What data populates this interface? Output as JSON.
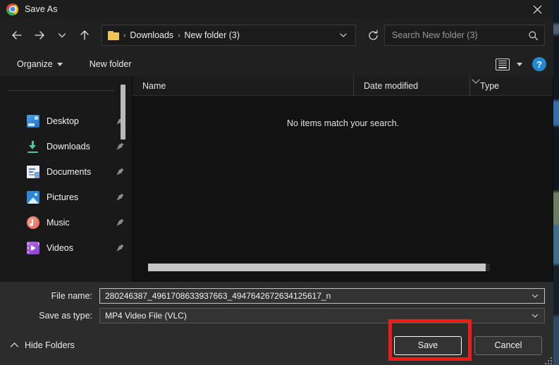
{
  "window": {
    "title": "Save As",
    "app_icon": "chrome-logo-icon",
    "close_label": "×"
  },
  "navbar": {
    "back_icon": "arrow-left-icon",
    "forward_icon": "arrow-right-icon",
    "recent_icon": "chevron-down-icon",
    "up_icon": "arrow-up-icon",
    "refresh_icon": "refresh-icon",
    "address": {
      "folder_icon": "folder-icon",
      "crumbs": [
        "Downloads",
        "New folder (3)"
      ],
      "separator": "›",
      "dropdown_icon": "chevron-down-icon"
    },
    "search": {
      "placeholder": "Search New folder (3)",
      "value": "",
      "icon": "search-icon"
    }
  },
  "toolbar": {
    "organize_label": "Organize",
    "organize_caret": "caret-down-icon",
    "new_folder_label": "New folder",
    "view_icon": "list-view-icon",
    "view_caret": "caret-down-icon",
    "help_label": "?",
    "help_icon": "help-icon"
  },
  "sidebar": {
    "items": [
      {
        "label": "Desktop",
        "icon": "desktop-icon",
        "pin": "pin-icon"
      },
      {
        "label": "Downloads",
        "icon": "downloads-icon",
        "pin": "pin-icon"
      },
      {
        "label": "Documents",
        "icon": "documents-icon",
        "pin": "pin-icon"
      },
      {
        "label": "Pictures",
        "icon": "pictures-icon",
        "pin": "pin-icon"
      },
      {
        "label": "Music",
        "icon": "music-icon",
        "pin": "pin-icon"
      },
      {
        "label": "Videos",
        "icon": "videos-icon",
        "pin": "pin-icon"
      }
    ]
  },
  "filelist": {
    "columns": [
      "Name",
      "Date modified",
      "Type"
    ],
    "sort_indicator": "chevron-up-sort-icon",
    "empty_message": "No items match your search.",
    "rows": []
  },
  "form": {
    "file_name_label": "File name:",
    "file_name_value": "280246387_4961708633937663_4947642672634125617_n",
    "save_as_type_label": "Save as type:",
    "save_as_type_value": "MP4 Video File (VLC)",
    "dropdown_icon": "chevron-down-icon"
  },
  "footer": {
    "hide_folders_label": "Hide Folders",
    "hide_folders_icon": "chevron-up-icon",
    "save_label": "Save",
    "cancel_label": "Cancel",
    "resize_grip_icon": "resize-grip-icon"
  },
  "annotation": {
    "color": "#ef1c1c",
    "target": "save-button"
  }
}
